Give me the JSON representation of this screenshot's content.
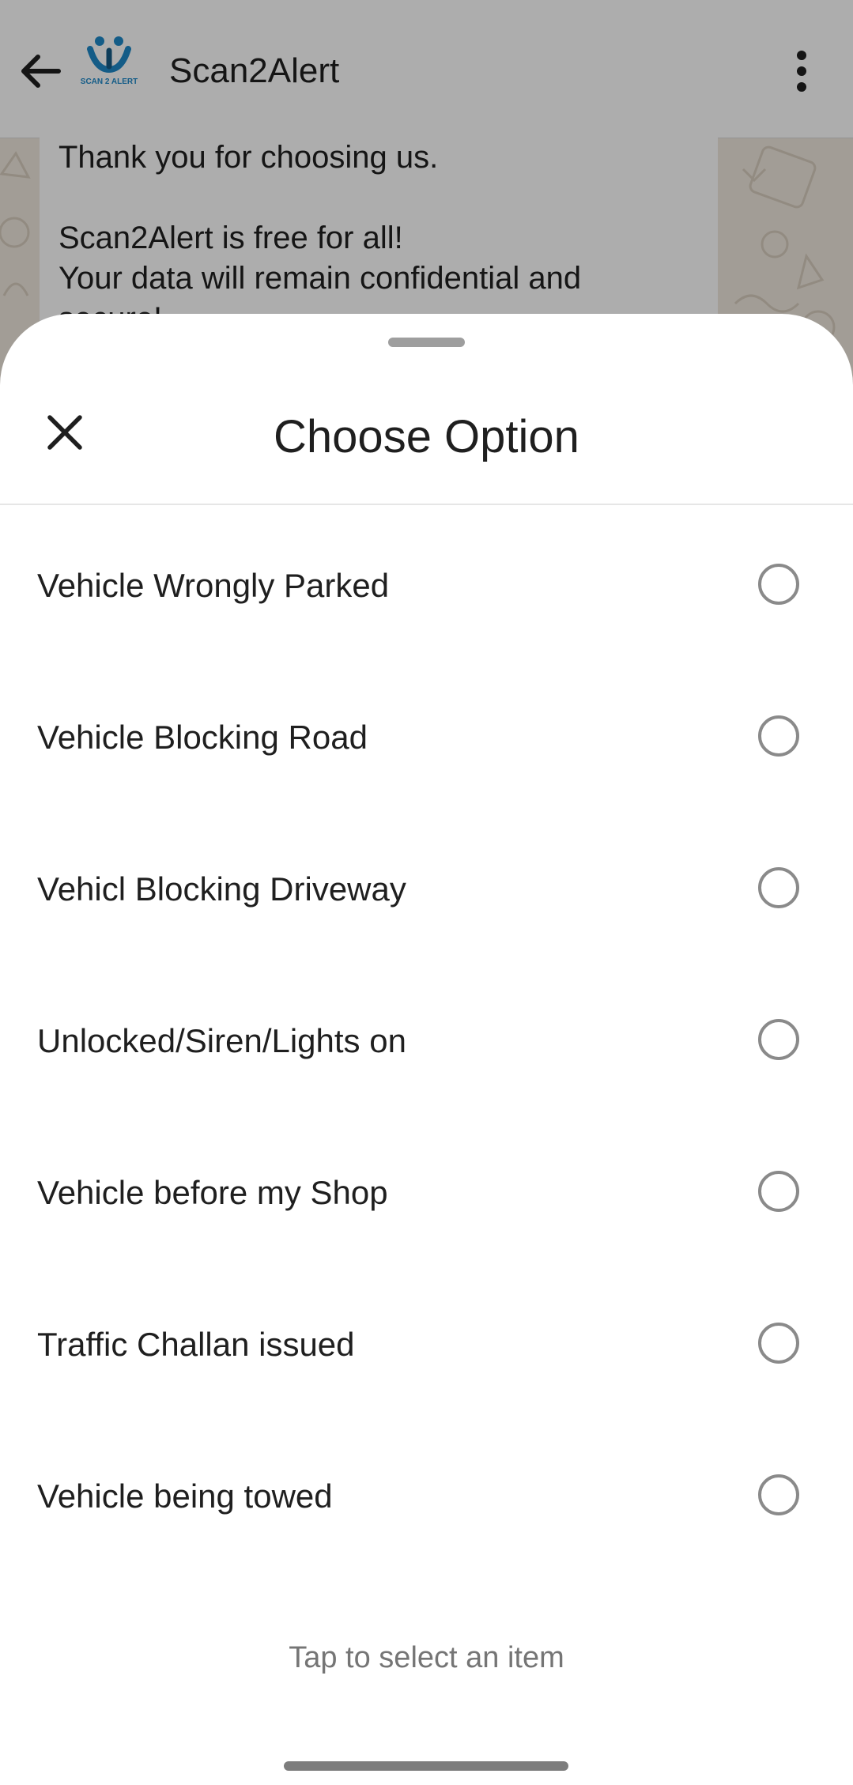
{
  "header": {
    "title": "Scan2Alert",
    "logo_text": "SCAN 2 ALERT",
    "back_icon": "arrow-left-icon",
    "menu_icon": "more-vertical-icon"
  },
  "chat": {
    "line1": "Thank you for choosing us.",
    "line2": "Scan2Alert is free for all!",
    "line3": "Your data will remain confidential and",
    "line4": "secure!"
  },
  "sheet": {
    "title": "Choose Option",
    "close_icon": "close-icon",
    "options": [
      {
        "label": "Vehicle Wrongly Parked",
        "selected": false
      },
      {
        "label": "Vehicle Blocking Road",
        "selected": false
      },
      {
        "label": "Vehicl Blocking Driveway",
        "selected": false
      },
      {
        "label": "Unlocked/Siren/Lights on",
        "selected": false
      },
      {
        "label": "Vehicle before my Shop",
        "selected": false
      },
      {
        "label": "Traffic Challan issued",
        "selected": false
      },
      {
        "label": "Vehicle being towed",
        "selected": false
      }
    ],
    "hint": "Tap to select an item"
  },
  "colors": {
    "scrim": "rgba(0,0,0,0.32)",
    "radio_border": "#8a8a8a",
    "logo_blue": "#1e88c8",
    "chat_background": "#efe7dd"
  }
}
